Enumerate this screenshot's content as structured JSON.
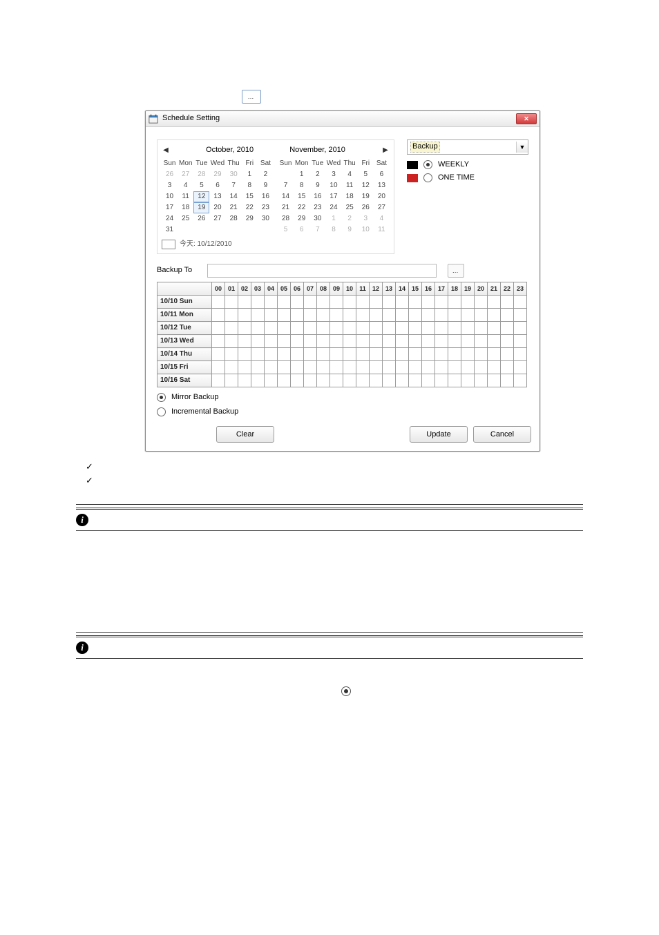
{
  "dialog": {
    "title": "Schedule Setting",
    "close_glyph": "✕",
    "prev_glyph": "◀",
    "next_glyph": "▶",
    "month_left": "October, 2010",
    "month_right": "November, 2010",
    "dow": [
      "Sun",
      "Mon",
      "Tue",
      "Wed",
      "Thu",
      "Fri",
      "Sat"
    ],
    "oct": [
      [
        {
          "v": "26",
          "o": 1
        },
        {
          "v": "27",
          "o": 1
        },
        {
          "v": "28",
          "o": 1
        },
        {
          "v": "29",
          "o": 1
        },
        {
          "v": "30",
          "o": 1
        },
        {
          "v": "1"
        },
        {
          "v": "2"
        }
      ],
      [
        {
          "v": "3"
        },
        {
          "v": "4"
        },
        {
          "v": "5"
        },
        {
          "v": "6"
        },
        {
          "v": "7"
        },
        {
          "v": "8"
        },
        {
          "v": "9"
        }
      ],
      [
        {
          "v": "10"
        },
        {
          "v": "11"
        },
        {
          "v": "12",
          "b": 1
        },
        {
          "v": "13"
        },
        {
          "v": "14"
        },
        {
          "v": "15"
        },
        {
          "v": "16"
        }
      ],
      [
        {
          "v": "17"
        },
        {
          "v": "18"
        },
        {
          "v": "19",
          "b": 1
        },
        {
          "v": "20"
        },
        {
          "v": "21"
        },
        {
          "v": "22"
        },
        {
          "v": "23"
        }
      ],
      [
        {
          "v": "24"
        },
        {
          "v": "25"
        },
        {
          "v": "26"
        },
        {
          "v": "27"
        },
        {
          "v": "28"
        },
        {
          "v": "29"
        },
        {
          "v": "30"
        }
      ],
      [
        {
          "v": "31"
        },
        {
          "v": ""
        },
        {
          "v": ""
        },
        {
          "v": ""
        },
        {
          "v": ""
        },
        {
          "v": ""
        },
        {
          "v": ""
        }
      ]
    ],
    "nov": [
      [
        {
          "v": ""
        },
        {
          "v": "1"
        },
        {
          "v": "2"
        },
        {
          "v": "3"
        },
        {
          "v": "4"
        },
        {
          "v": "5"
        },
        {
          "v": "6"
        }
      ],
      [
        {
          "v": "7"
        },
        {
          "v": "8"
        },
        {
          "v": "9"
        },
        {
          "v": "10"
        },
        {
          "v": "11"
        },
        {
          "v": "12"
        },
        {
          "v": "13"
        }
      ],
      [
        {
          "v": "14"
        },
        {
          "v": "15"
        },
        {
          "v": "16"
        },
        {
          "v": "17"
        },
        {
          "v": "18"
        },
        {
          "v": "19"
        },
        {
          "v": "20"
        }
      ],
      [
        {
          "v": "21"
        },
        {
          "v": "22"
        },
        {
          "v": "23"
        },
        {
          "v": "24"
        },
        {
          "v": "25"
        },
        {
          "v": "26"
        },
        {
          "v": "27"
        }
      ],
      [
        {
          "v": "28"
        },
        {
          "v": "29"
        },
        {
          "v": "30"
        },
        {
          "v": "1",
          "o": 1
        },
        {
          "v": "2",
          "o": 1
        },
        {
          "v": "3",
          "o": 1
        },
        {
          "v": "4",
          "o": 1
        }
      ],
      [
        {
          "v": "5",
          "o": 1
        },
        {
          "v": "6",
          "o": 1
        },
        {
          "v": "7",
          "o": 1
        },
        {
          "v": "8",
          "o": 1
        },
        {
          "v": "9",
          "o": 1
        },
        {
          "v": "10",
          "o": 1
        },
        {
          "v": "11",
          "o": 1
        }
      ]
    ],
    "today_label": "今天: 10/12/2010",
    "combo_value": "Backup",
    "combo_arrow": "▼",
    "legend_weekly": "WEEKLY",
    "legend_onetime": "ONE TIME",
    "backup_to_label": "Backup To",
    "browse_glyph": "…",
    "hours": [
      "00",
      "01",
      "02",
      "03",
      "04",
      "05",
      "06",
      "07",
      "08",
      "09",
      "10",
      "11",
      "12",
      "13",
      "14",
      "15",
      "16",
      "17",
      "18",
      "19",
      "20",
      "21",
      "22",
      "23"
    ],
    "days": [
      "10/10 Sun",
      "10/11 Mon",
      "10/12 Tue",
      "10/13 Wed",
      "10/14 Thu",
      "10/15 Fri",
      "10/16 Sat"
    ],
    "radio_mirror": "Mirror Backup",
    "radio_incremental": "Incremental Backup",
    "btn_clear": "Clear",
    "btn_update": "Update",
    "btn_cancel": "Cancel"
  },
  "ellipsis": "…",
  "check_glyph": "✓"
}
